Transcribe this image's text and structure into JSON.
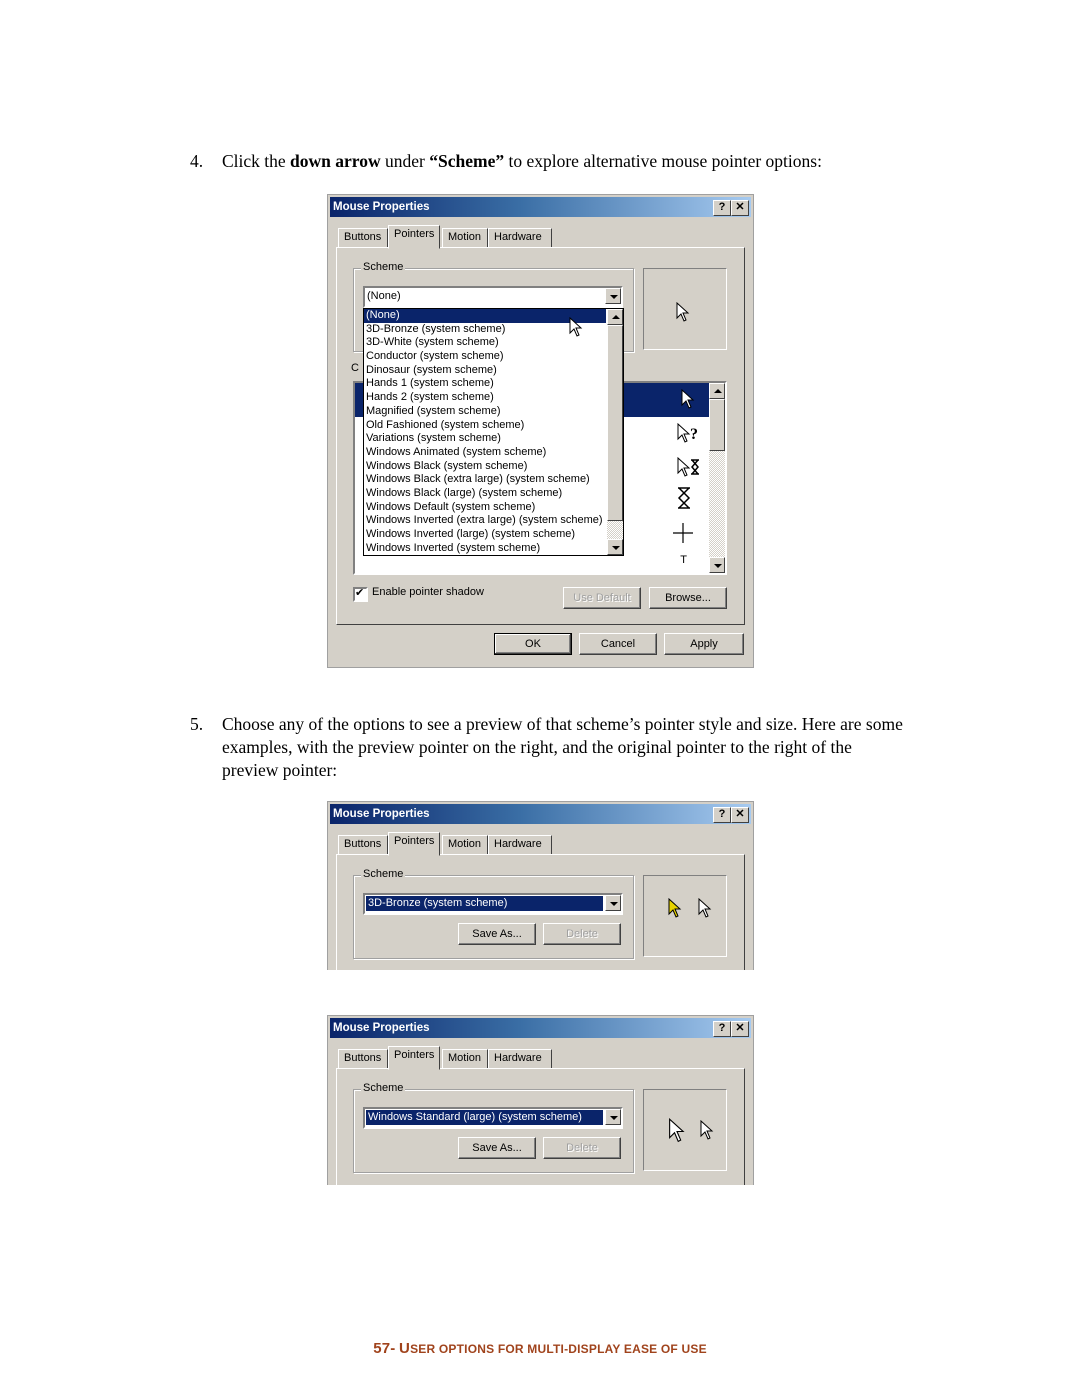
{
  "step4": {
    "number": "4.",
    "pre": "Click the ",
    "bold1": "down arrow",
    "mid": " under ",
    "bold2": "“Scheme”",
    "post": " to explore alternative mouse pointer options:"
  },
  "step5": {
    "number": "5.",
    "text": "Choose any of the options to see a preview of that scheme’s pointer style and size. Here are some examples, with the preview pointer on the right, and the original pointer to the right of the preview pointer:"
  },
  "dialog_common": {
    "title": "Mouse Properties",
    "help_label": "?",
    "close_label": "✕",
    "tabs": [
      "Buttons",
      "Pointers",
      "Motion",
      "Hardware"
    ],
    "active_tab": "Pointers",
    "scheme_label": "Scheme",
    "save_as": "Save As...",
    "delete": "Delete"
  },
  "dialog1": {
    "scheme_value": "(None)",
    "customize_partial": "C",
    "scheme_options": [
      "(None)",
      "3D-Bronze (system scheme)",
      "3D-White (system scheme)",
      "Conductor (system scheme)",
      "Dinosaur (system scheme)",
      "Hands 1 (system scheme)",
      "Hands 2 (system scheme)",
      "Magnified (system scheme)",
      "Old Fashioned (system scheme)",
      "Variations (system scheme)",
      "Windows Animated (system scheme)",
      "Windows Black  (system scheme)",
      "Windows Black (extra large) (system scheme)",
      "Windows Black (large) (system scheme)",
      "Windows Default (system scheme)",
      "Windows Inverted (extra large) (system scheme)",
      "Windows Inverted (large) (system scheme)",
      "Windows Inverted (system scheme)"
    ],
    "highlighted_option": "(None)",
    "cursor_icons": [
      "normal-select",
      "help-select",
      "working-in-background",
      "busy",
      "precision-select",
      "text-select"
    ],
    "enable_shadow_label": "Enable pointer shadow",
    "enable_shadow_checked": true,
    "use_default": "Use Default",
    "browse": "Browse...",
    "ok": "OK",
    "cancel": "Cancel",
    "apply": "Apply"
  },
  "dialog2": {
    "scheme_value": "3D-Bronze (system scheme)"
  },
  "dialog3": {
    "scheme_value": "Windows Standard (large) (system scheme)"
  },
  "footer": {
    "page": "57-",
    "first_letter": "U",
    "rest": "SER OPTIONS FOR MULTI-DISPLAY EASE OF USE"
  },
  "colors": {
    "titlebar": "#0a246a",
    "selection": "#0a246a",
    "dialog_bg": "#d4d0c8",
    "footer": "#a0431c"
  }
}
